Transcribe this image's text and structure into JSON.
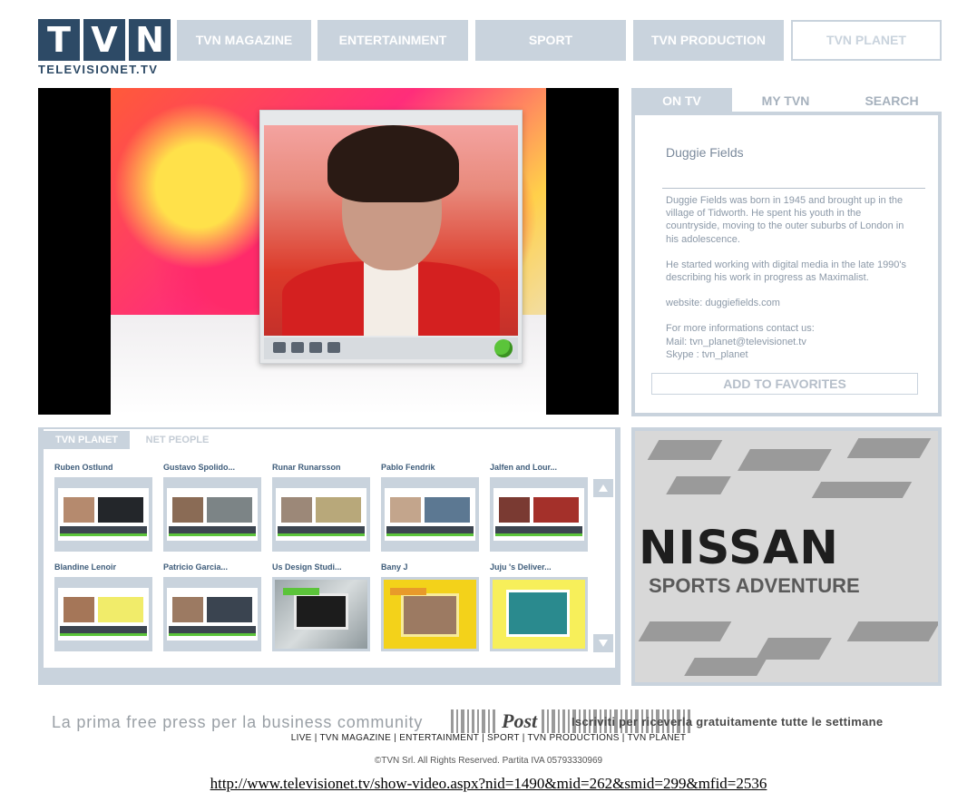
{
  "logo": {
    "letters": [
      "T",
      "V",
      "N"
    ],
    "subtitle": "TELEVISIONET.TV"
  },
  "nav": {
    "items": [
      "TVN MAGAZINE",
      "ENTERTAINMENT",
      "SPORT",
      "TVN PRODUCTION",
      "TVN PLANET"
    ],
    "active": "TVN PLANET"
  },
  "info": {
    "tabs": [
      "ON TV",
      "MY TVN",
      "SEARCH"
    ],
    "active_tab": "ON TV",
    "title": "Duggie Fields",
    "paragraphs": [
      "Duggie Fields was born in 1945 and brought up in the village of Tidworth. He spent his youth in the countryside, moving to the outer suburbs of London in his adolescence.",
      "He started working with digital media in the late 1990's describing his work in progress as Maximalist.",
      "website: duggiefields.com"
    ],
    "contact": [
      "For more informations contact us:",
      "Mail: tvn_planet@televisionet.tv",
      "Skype : tvn_planet"
    ],
    "favorites_label": "ADD TO FAVORITES"
  },
  "planet": {
    "tabs": [
      "TVN PLANET",
      "NET PEOPLE"
    ],
    "active_tab": "TVN PLANET",
    "videos": [
      "Ruben Ostlund",
      "Gustavo Spolido...",
      "Runar Runarsson",
      "Pablo Fendrik",
      "Jalfen and Lour...",
      "Blandine Lenoir",
      "Patricio Garcia...",
      "Us Design Studi...",
      "Bany J",
      "Juju 's Deliver..."
    ]
  },
  "ad": {
    "brand": "NISSAN",
    "tagline": "SPORTS ADVENTURE"
  },
  "footer": {
    "promo_left": "La prima free press per la business community",
    "promo_brand": "Post",
    "promo_right": "Iscriviti per riceverla gratuitamente tutte le settimane",
    "links": [
      "LIVE",
      "TVN MAGAZINE",
      "ENTERTAINMENT",
      "SPORT",
      "TVN PRODUCTIONS",
      "TVN PLANET"
    ],
    "copyright": "©TVN Srl. All Rights Reserved. Partita IVA 05793330969",
    "url": "http://www.televisionet.tv/show-video.aspx?nid=1490&mid=262&smid=299&mfid=2536"
  },
  "colors": {
    "brand": "#2d4a66",
    "accent": "#c9d3dd",
    "green": "#5bc43a"
  }
}
